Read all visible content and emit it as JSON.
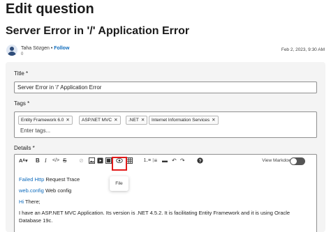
{
  "page": {
    "title": "Edit question"
  },
  "question": {
    "title": "Server Error in '/' Application Error"
  },
  "author": {
    "name": "Taha Sözgen",
    "separator": "•",
    "follow_label": "Follow",
    "count": "0",
    "date": "Feb 2, 2023, 9:30 AM"
  },
  "form": {
    "title_label": "Title *",
    "title_value": "Server Error in '/' Application Error",
    "tags_label": "Tags *",
    "tags": [
      "Entity Framework 6.0",
      "ASP.NET MVC",
      ".NET",
      "Internet Information Services"
    ],
    "tags_placeholder": "Enter tags...",
    "details_label": "Details *"
  },
  "editor": {
    "toolbar": {
      "icons": [
        "font-size-icon",
        "bold-icon",
        "italic-icon",
        "code-icon",
        "strikethrough-icon",
        "link-icon",
        "image-icon",
        "video-icon",
        "file-icon",
        "table-icon",
        "numbered-list-icon",
        "bulleted-list-icon",
        "horizontal-rule-icon",
        "undo-icon",
        "redo-icon",
        "help-icon"
      ],
      "view_markdown_label": "View Markdown",
      "tooltip": "File"
    },
    "content": {
      "line1_link": "Failed Http",
      "line1_text": " Request Trace",
      "line2_link": "web.config",
      "line2_text": " Web config",
      "line3_link": "Hi",
      "line3_text": " There;",
      "line4": "I have an ASP.NET MVC Application. Its version is .NET 4.5.2. It is facilitating Entity Framework and it is using Oracle",
      "line5": "Database 19c."
    }
  },
  "colors": {
    "accent": "#0f6cbd",
    "highlight": "#e21a1a",
    "panel_bg": "#f4f4f4"
  }
}
